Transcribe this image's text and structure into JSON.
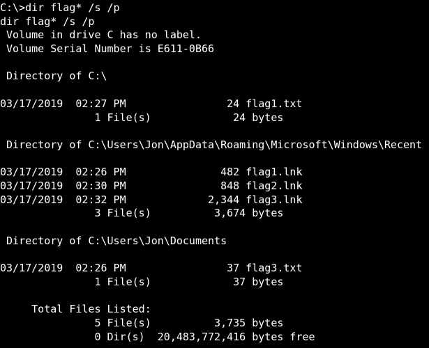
{
  "terminal": {
    "colors": {
      "background": "#000000",
      "foreground": "#ffffff"
    },
    "lines": [
      "C:\\>dir flag* /s /p",
      "dir flag* /s /p",
      " Volume in drive C has no label.",
      " Volume Serial Number is E611-0B66",
      "",
      " Directory of C:\\",
      "",
      "03/17/2019  02:27 PM                24 flag1.txt",
      "               1 File(s)             24 bytes",
      "",
      " Directory of C:\\Users\\Jon\\AppData\\Roaming\\Microsoft\\Windows\\Recent",
      "",
      "03/17/2019  02:26 PM               482 flag1.lnk",
      "03/17/2019  02:30 PM               848 flag2.lnk",
      "03/17/2019  02:32 PM             2,344 flag3.lnk",
      "               3 File(s)          3,674 bytes",
      "",
      " Directory of C:\\Users\\Jon\\Documents",
      "",
      "03/17/2019  02:26 PM                37 flag3.txt",
      "               1 File(s)             37 bytes",
      "",
      "     Total Files Listed:",
      "               5 File(s)          3,735 bytes",
      "               0 Dir(s)  20,483,772,416 bytes free"
    ]
  }
}
